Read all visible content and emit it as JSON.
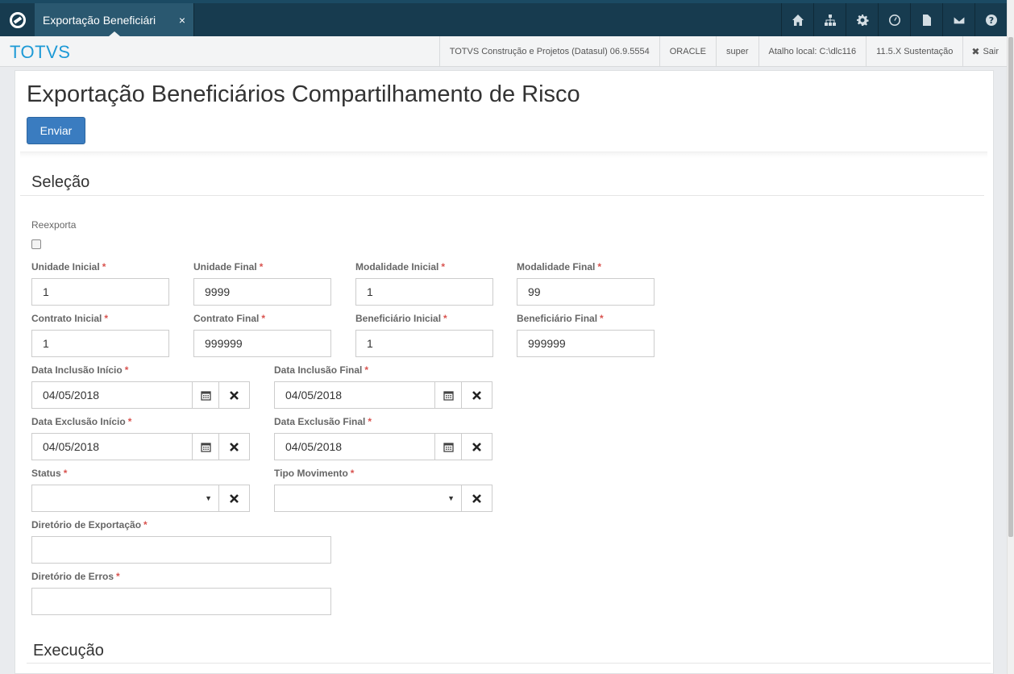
{
  "topbar": {
    "tab_label": "Exportação Beneficiári",
    "tab_close": "×",
    "icons": [
      "home-icon",
      "sitemap-icon",
      "gear-icon",
      "clock-icon",
      "document-icon",
      "envelope-icon",
      "help-icon"
    ]
  },
  "subbar": {
    "brand": "TOTVS",
    "items": [
      "TOTVS Construção e Projetos (Datasul) 06.9.5554",
      "ORACLE",
      "super",
      "Atalho local: C:\\dlc116",
      "11.5.X Sustentação"
    ],
    "exit_label": "Sair",
    "exit_icon": "✖"
  },
  "page": {
    "title": "Exportação Beneficiários Compartilhamento de Risco",
    "send_button": "Enviar"
  },
  "sections": {
    "selection": "Seleção",
    "execution": "Execução"
  },
  "form": {
    "reexport_label": "Reexporta",
    "required_mark": "*",
    "unidade_inicial": {
      "label": "Unidade Inicial",
      "value": "1"
    },
    "unidade_final": {
      "label": "Unidade Final",
      "value": "9999"
    },
    "modalidade_inicial": {
      "label": "Modalidade Inicial",
      "value": "1"
    },
    "modalidade_final": {
      "label": "Modalidade Final",
      "value": "99"
    },
    "contrato_inicial": {
      "label": "Contrato Inicial",
      "value": "1"
    },
    "contrato_final": {
      "label": "Contrato Final",
      "value": "999999"
    },
    "beneficiario_inicial": {
      "label": "Beneficiário Inicial",
      "value": "1"
    },
    "beneficiario_final": {
      "label": "Beneficiário Final",
      "value": "999999"
    },
    "data_inclusao_inicio": {
      "label": "Data Inclusão Início",
      "value": "04/05/2018"
    },
    "data_inclusao_final": {
      "label": "Data Inclusão Final",
      "value": "04/05/2018"
    },
    "data_exclusao_inicio": {
      "label": "Data Exclusão Início",
      "value": "04/05/2018"
    },
    "data_exclusao_final": {
      "label": "Data Exclusão Final",
      "value": "04/05/2018"
    },
    "status": {
      "label": "Status",
      "value": "",
      "arrow": "▼"
    },
    "tipo_movimento": {
      "label": "Tipo Movimento",
      "value": "",
      "arrow": "▼"
    },
    "diretorio_exportacao": {
      "label": "Diretório de Exportação",
      "value": ""
    },
    "diretorio_erros": {
      "label": "Diretório de Erros",
      "value": ""
    }
  },
  "colors": {
    "topbar": "#173b4f",
    "tab_active": "#2a5870",
    "brand": "#1e9ad6",
    "primary_button": "#3a7cc0",
    "required": "#d9534f"
  }
}
